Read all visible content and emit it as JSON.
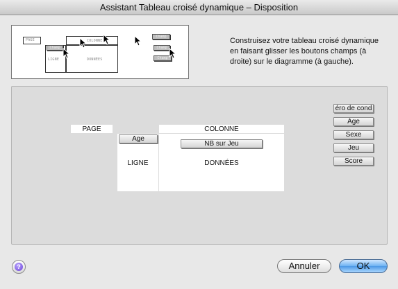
{
  "window": {
    "title": "Assistant Tableau croisé dynamique – Disposition"
  },
  "diagram": {
    "page_mini": "PAGE",
    "col_mini": "COLONNE",
    "row_mini": "LIGNE",
    "data_mini": "DONNÉES",
    "chip_a": "Champ",
    "chip_b": "Champ",
    "chip_c": "Champ",
    "chip_mini_row": "Champ"
  },
  "instructions": {
    "text": "Construisez votre tableau croisé dynamique en faisant glisser les boutons champs (à droite) sur le diagramme (à gauche)."
  },
  "layout": {
    "page_label": "PAGE",
    "column_label": "COLONNE",
    "row_label": "LIGNE",
    "data_label": "DONNÉES",
    "row_field": "Age",
    "data_field": "NB sur Jeu"
  },
  "fields": [
    {
      "label": "éro de cond"
    },
    {
      "label": "Age"
    },
    {
      "label": "Sexe"
    },
    {
      "label": "Jeu"
    },
    {
      "label": "Score"
    }
  ],
  "buttons": {
    "cancel": "Annuler",
    "ok": "OK"
  },
  "colors": {
    "accent": "#5aa5ec",
    "panel": "#dcdcdc"
  },
  "icons": {
    "help": "help-icon",
    "cursor": "arrow-cursor-icon"
  }
}
